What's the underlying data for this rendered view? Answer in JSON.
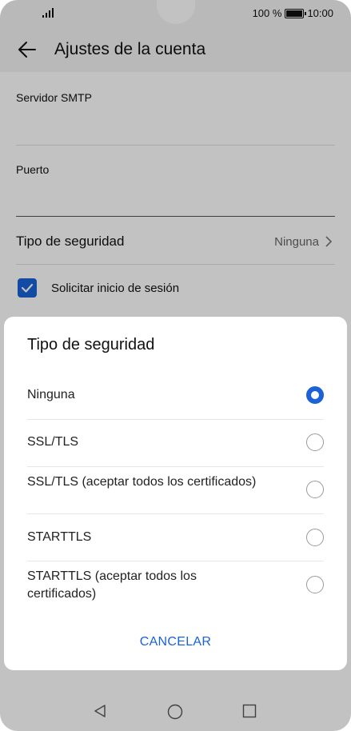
{
  "status": {
    "battery_text": "100 %",
    "time": "10:00"
  },
  "header": {
    "title": "Ajustes de la cuenta"
  },
  "settings": {
    "smtp_label": "Servidor SMTP",
    "port_label": "Puerto",
    "security_label": "Tipo de seguridad",
    "security_value": "Ninguna",
    "login_label": "Solicitar inicio de sesión",
    "login_checked": true
  },
  "dialog": {
    "title": "Tipo de seguridad",
    "options": [
      {
        "label": "Ninguna",
        "selected": true
      },
      {
        "label": "SSL/TLS",
        "selected": false
      },
      {
        "label": "SSL/TLS (aceptar todos los certificados)",
        "selected": false
      },
      {
        "label": "STARTTLS",
        "selected": false
      },
      {
        "label": "STARTTLS (aceptar todos los certificados)",
        "selected": false
      }
    ],
    "cancel_label": "CANCELAR"
  },
  "colors": {
    "accent": "#1a62d6"
  },
  "icons": {
    "back": "arrow-left-icon",
    "chevron": "chevron-right-icon",
    "nav_back": "triangle-back-icon",
    "nav_home": "circle-home-icon",
    "nav_recent": "square-recent-icon"
  }
}
